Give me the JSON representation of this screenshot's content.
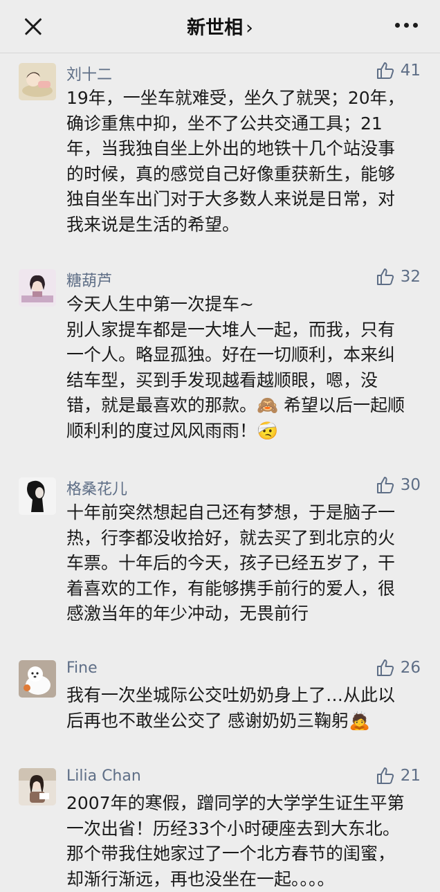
{
  "header": {
    "title": "新世相",
    "title_chevron": "›"
  },
  "comments": [
    {
      "name": "刘十二",
      "likes": "41",
      "lines": [
        "19年，一坐车就难受，坐久了就哭；20年，",
        "确诊重焦中抑，坐不了公共交通工具；21",
        "年，当我独自坐上外出的地铁十几个站没事",
        "的时候，真的感觉自己好像重获新生，能够",
        "独自坐车出门对于大多数人来说是日常，对",
        "我来说是生活的希望。"
      ]
    },
    {
      "name": "糖葫芦",
      "likes": "32",
      "lines": [
        "今天人生中第一次提车~",
        "别人家提车都是一大堆人一起，而我，只有",
        "一个人。略显孤独。好在一切顺利，本来纠",
        "结车型，买到手发现越看越顺眼，嗯，没",
        "错，就是最喜欢的那款。🙈 希望以后一起顺",
        "顺利利的度过风风雨雨！🤕"
      ]
    },
    {
      "name": "格桑花儿",
      "likes": "30",
      "lines": [
        "十年前突然想起自己还有梦想，于是脑子一",
        "热，行李都没收拾好，就去买了到北京的火",
        "车票。十年后的今天，孩子已经五岁了，干",
        "着喜欢的工作，有能够携手前行的爱人，很",
        "感激当年的年少冲动，无畏前行"
      ]
    },
    {
      "name": "Fine",
      "likes": "26",
      "lines": [
        "我有一次坐城际公交吐奶奶身上了…从此以",
        "后再也不敢坐公交了 感谢奶奶三鞠躬🙇"
      ]
    },
    {
      "name": "Lilia Chan",
      "likes": "21",
      "lines": [
        "2007年的寒假，蹭同学的大学学生证生平第",
        "一次出省！历经33个小时硬座去到大东北。",
        "那个带我住她家过了一个北方春节的闺蜜，",
        "却渐行渐远，再也没坐在一起。。。。"
      ]
    }
  ]
}
